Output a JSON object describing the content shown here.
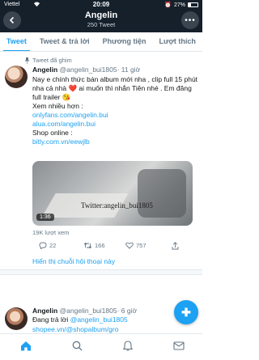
{
  "status_bar": {
    "carrier": "Viettel",
    "time": "20:09",
    "battery": "27%",
    "battery_level": 0.27
  },
  "header": {
    "name": "Angelin",
    "tweet_count": "250 Tweet"
  },
  "tabs": [
    {
      "label": "Tweet"
    },
    {
      "label": "Tweet & trả lời"
    },
    {
      "label": "Phương tiện"
    },
    {
      "label": "Lượt thích"
    }
  ],
  "pinned_tweet": {
    "pinned_label": "Tweet đã ghim",
    "name": "Angelin",
    "handle": "@angelin_bui1805",
    "time": "· 11 giờ",
    "text_line1": "Nay e chính thức bán album mới nha , clip full 15 phút nha cả nhà",
    "text_line1_after": "ai muốn thì nhắn Tiên nhé . Em đăng full trailer",
    "emoji_heart": "❤️",
    "emoji_face": "😘",
    "text_line2": "Xem nhiều hơn :",
    "link1": "onlyfans.com/angelin.bui",
    "link2": "alua.com/angelin.bui",
    "text_line3": "Shop online :",
    "link3": "bitly.com.vn/eewjlb",
    "media": {
      "watermark": "Twitter:angelin_bui1805",
      "duration": "1:36"
    },
    "views": "19K lượt xem",
    "reply_count": "22",
    "retweet_count": "166",
    "like_count": "757",
    "show_thread": "Hiển thị chuỗi hội thoại này"
  },
  "second_tweet": {
    "name": "Angelin",
    "handle": "@angelin_bui1805",
    "time": "· 6 giờ",
    "reply_prefix": "Đang trả lời",
    "reply_to": "@angelin_bui1805",
    "line3": "shopee.vn/@shopalbum/gro"
  },
  "fab": {
    "icon": "compose-plus-icon"
  },
  "bottom_nav": [
    {
      "icon": "home-icon"
    },
    {
      "icon": "search-icon"
    },
    {
      "icon": "bell-icon"
    },
    {
      "icon": "mail-icon"
    }
  ]
}
